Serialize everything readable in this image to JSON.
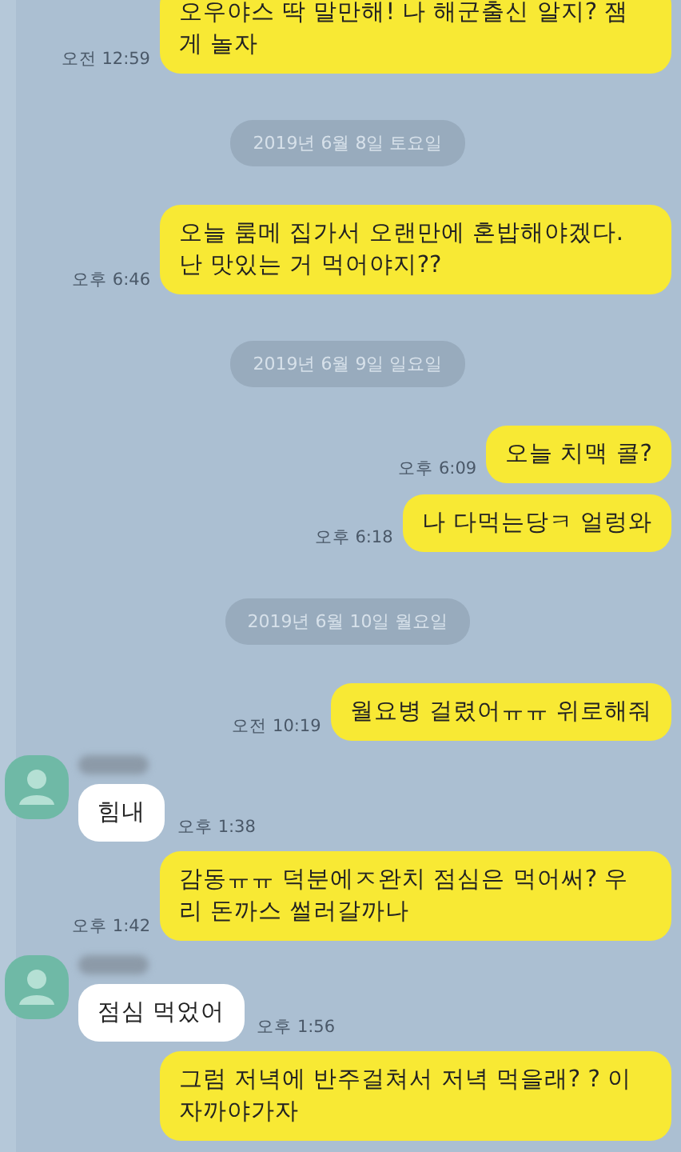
{
  "messages": [
    {
      "kind": "sent",
      "text": "오우야스 딱 말만해! 나 해군출신 알지? 잼게 놀자",
      "time": "오전 12:59"
    },
    {
      "kind": "date",
      "text": "2019년 6월 8일 토요일"
    },
    {
      "kind": "sent",
      "text": "오늘 룸메 집가서 오랜만에 혼밥해야겠다. 난 맛있는 거 먹어야지??",
      "time": "오후 6:46"
    },
    {
      "kind": "date",
      "text": "2019년 6월 9일 일요일"
    },
    {
      "kind": "sent",
      "text": "오늘 치맥 콜?",
      "time": "오후 6:09"
    },
    {
      "kind": "sent",
      "text": "나 다먹는당ㅋ 얼렁와",
      "time": "오후 6:18"
    },
    {
      "kind": "date",
      "text": "2019년 6월 10일 월요일"
    },
    {
      "kind": "sent",
      "text": "월요병 걸렸어ㅠㅠ 위로해줘",
      "time": "오전 10:19"
    },
    {
      "kind": "received",
      "text": "힘내",
      "time": "오후 1:38"
    },
    {
      "kind": "sent",
      "text": "감동ㅠㅠ 덕분에ㅈ완치 점심은 먹어써? 우리 돈까스 썰러갈까나",
      "time": "오후 1:42"
    },
    {
      "kind": "received",
      "text": "점심 먹었어",
      "time": "오후 1:56"
    },
    {
      "kind": "sent",
      "text": "그럼 저녁에 반주걸쳐서 저녁 먹을래? ? 이자까야가자"
    }
  ]
}
